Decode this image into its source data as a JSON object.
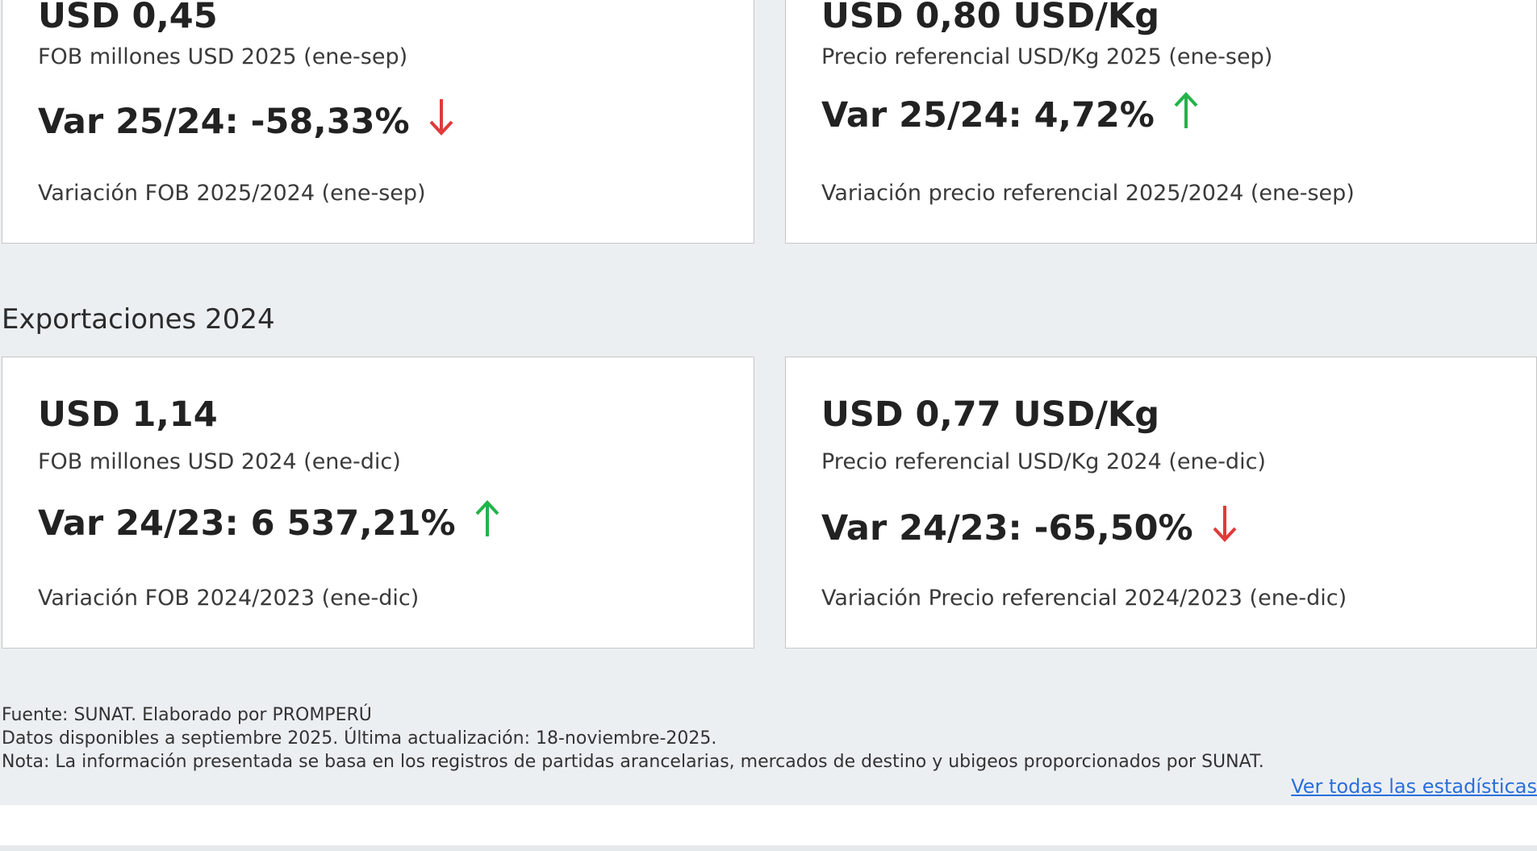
{
  "exports_2025": {
    "fob_card": {
      "value": "USD 0,45",
      "label": "FOB millones USD 2025 (ene-sep)",
      "variation": "Var 25/24: -58,33%",
      "variation_label": "Variación FOB 2025/2024 (ene-sep)",
      "trend": "down"
    },
    "price_card": {
      "value": "USD 0,80 USD/Kg",
      "label": "Precio referencial USD/Kg 2025 (ene-sep)",
      "variation": "Var 25/24: 4,72%",
      "variation_label": "Variación precio referencial 2025/2024 (ene-sep)",
      "trend": "up"
    }
  },
  "exports_2024": {
    "title": "Exportaciones 2024",
    "fob_card": {
      "value": "USD 1,14",
      "label": "FOB millones USD 2024 (ene-dic)",
      "variation": "Var 24/23: 6 537,21%",
      "variation_label": "Variación FOB 2024/2023 (ene-dic)",
      "trend": "up"
    },
    "price_card": {
      "value": "USD 0,77 USD/Kg",
      "label": "Precio referencial USD/Kg 2024 (ene-dic)",
      "variation": "Var 24/23: -65,50%",
      "variation_label": "Variación Precio referencial 2024/2023 (ene-dic)",
      "trend": "down"
    }
  },
  "footer": {
    "source": "Fuente: SUNAT. Elaborado por PROMPERÚ",
    "availability": "Datos disponibles a septiembre 2025. Última actualización: 18-noviembre-2025.",
    "note": "Nota: La información presentada se basa en los registros de partidas arancelarias, mercados de destino y ubigeos proporcionados por SUNAT.",
    "link_label": "Ver todas las estadísticas"
  },
  "icons": {
    "up": "arrow-up-icon",
    "down": "arrow-down-icon"
  },
  "colors": {
    "up": "#22b34a",
    "down": "#e03a3a",
    "link": "#2a6fdb",
    "background": "#eceff2",
    "card": "#ffffff"
  }
}
